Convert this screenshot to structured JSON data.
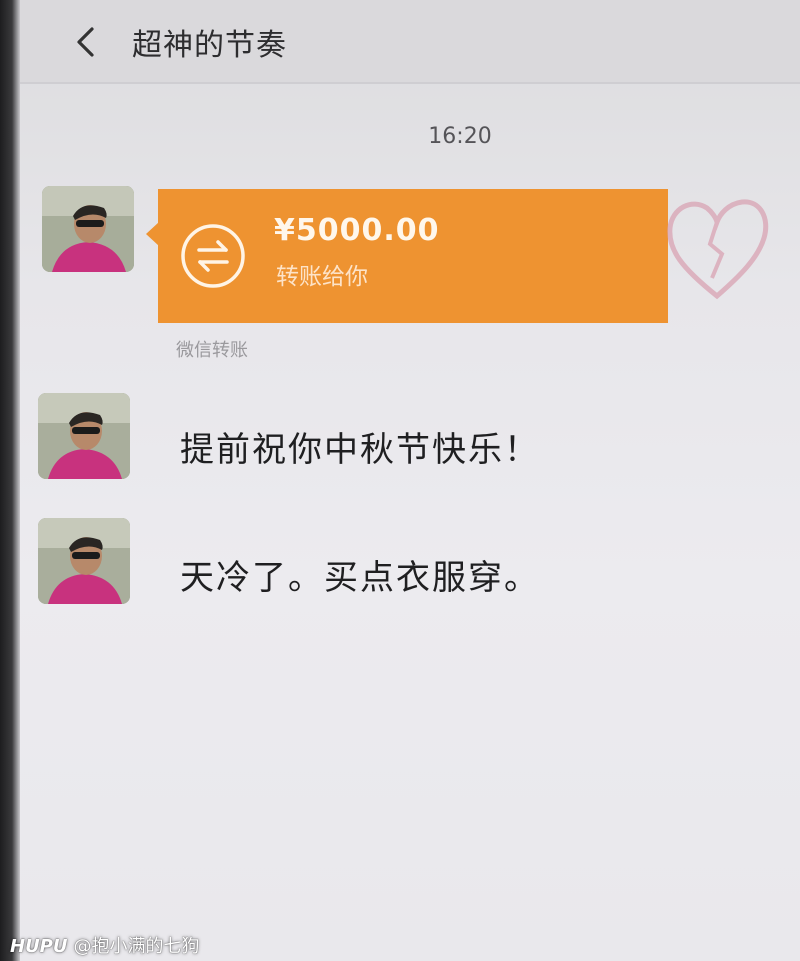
{
  "header": {
    "title": "超神的节奏",
    "back_icon": "chevron-left-icon"
  },
  "chat": {
    "time": "16:20",
    "transfer": {
      "amount": "¥5000.00",
      "subtitle": "转账给你",
      "label": "微信转账",
      "icon": "transfer-arrows-icon",
      "color": "#ee9331"
    },
    "messages": [
      {
        "text": "提前祝你中秋节快乐！"
      },
      {
        "text": "天冷了。买点衣服穿。"
      }
    ]
  },
  "watermark": {
    "brand": "HUPU",
    "text": "@抱小满的七狗"
  }
}
